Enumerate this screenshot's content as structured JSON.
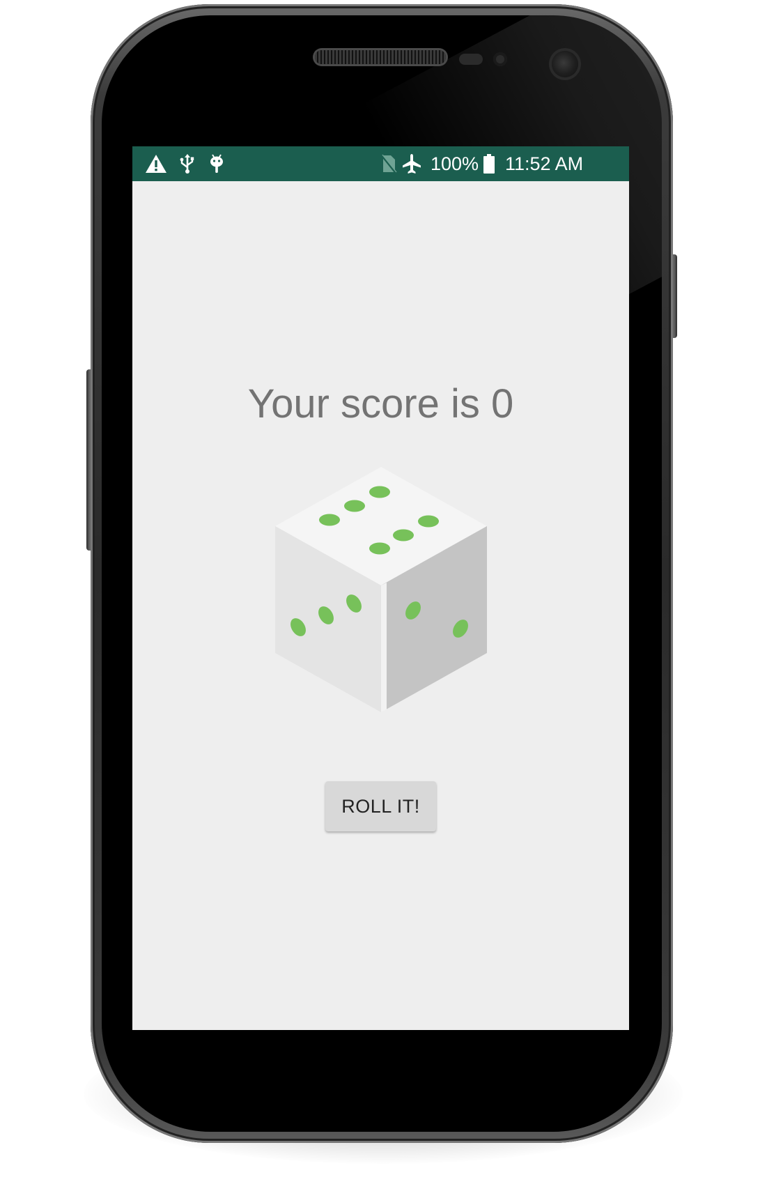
{
  "status_bar": {
    "battery": "100%",
    "time": "11:52 AM",
    "left_icons": [
      "warning-icon",
      "usb-icon",
      "android-debug-icon"
    ],
    "right_icons": [
      "no-sim-icon",
      "airplane-mode-icon",
      "battery-full-icon"
    ],
    "background_color": "#1b5e4f"
  },
  "main": {
    "score_text": "Your score is 0",
    "dice": {
      "top_face_pips": 6,
      "left_face_pips": 3,
      "right_face_pips": 2,
      "pip_color": "#77c15a"
    },
    "roll_button_label": "ROLL IT!"
  }
}
